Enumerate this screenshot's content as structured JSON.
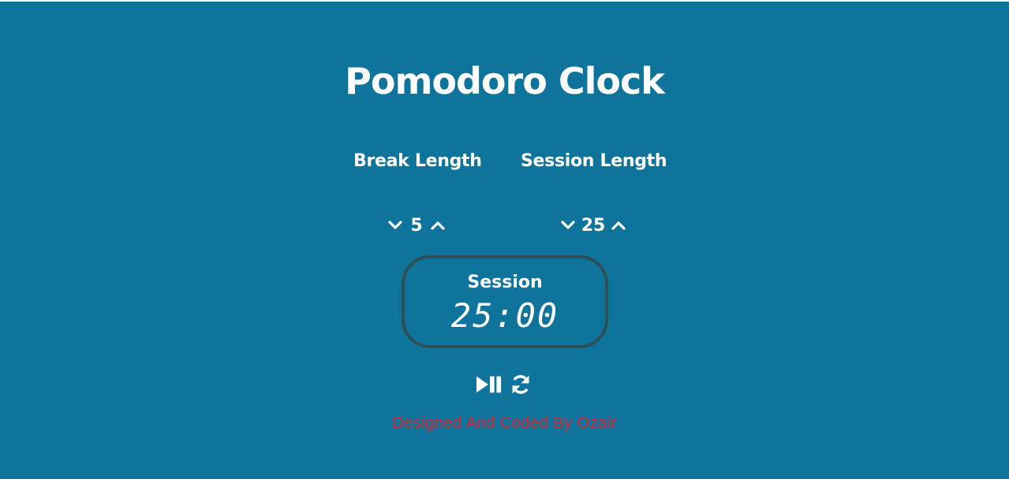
{
  "app": {
    "title": "Pomodoro Clock"
  },
  "break": {
    "label": "Break Length",
    "value": "5",
    "decrement_icon": "chevron-down-icon",
    "increment_icon": "chevron-up-icon"
  },
  "session": {
    "label": "Session Length",
    "value": "25",
    "decrement_icon": "chevron-down-icon",
    "increment_icon": "chevron-up-icon"
  },
  "timer": {
    "label": "Session",
    "time": "25:00"
  },
  "controls": {
    "play_pause_icon": "play-pause-icon",
    "reset_icon": "refresh-icon"
  },
  "footer": {
    "text": "Designed And Coded By Ozair"
  },
  "colors": {
    "background": "#0e749c",
    "text": "#ffffff",
    "timer_border": "#2e4f57",
    "footer": "#e02434"
  }
}
